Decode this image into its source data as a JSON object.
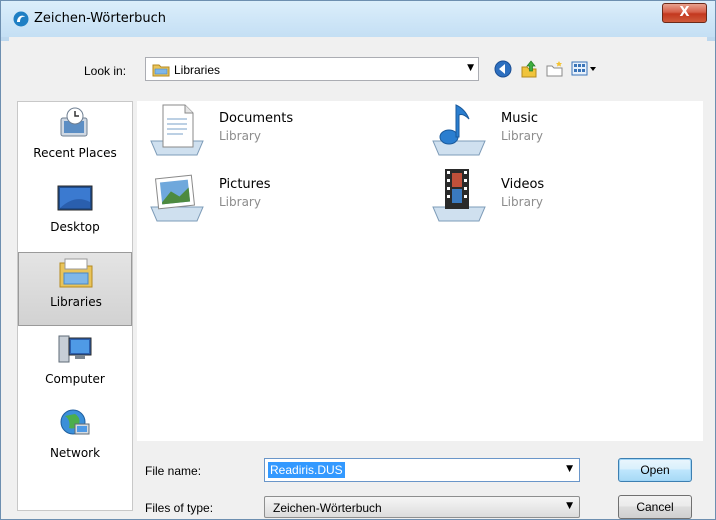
{
  "window": {
    "title": "Zeichen-Wörterbuch",
    "close_label": "X"
  },
  "lookin": {
    "label": "Look in:",
    "value": "Libraries"
  },
  "places": [
    {
      "label": "Recent Places",
      "icon": "recent-places-icon"
    },
    {
      "label": "Desktop",
      "icon": "desktop-icon"
    },
    {
      "label": "Libraries",
      "icon": "libraries-icon",
      "selected": true
    },
    {
      "label": "Computer",
      "icon": "computer-icon"
    },
    {
      "label": "Network",
      "icon": "network-icon"
    }
  ],
  "items": [
    {
      "name": "Documents",
      "type": "Library",
      "icon": "documents-library-icon"
    },
    {
      "name": "Music",
      "type": "Library",
      "icon": "music-library-icon"
    },
    {
      "name": "Pictures",
      "type": "Library",
      "icon": "pictures-library-icon"
    },
    {
      "name": "Videos",
      "type": "Library",
      "icon": "videos-library-icon"
    }
  ],
  "filename": {
    "label": "File name:",
    "value": "Readiris.DUS"
  },
  "filetype": {
    "label": "Files of type:",
    "value": "Zeichen-Wörterbuch"
  },
  "buttons": {
    "open": "Open",
    "cancel": "Cancel"
  },
  "colors": {
    "selection": "#3399ff",
    "default_button_border": "#3c7fb1",
    "close_button": "#c3381f"
  }
}
